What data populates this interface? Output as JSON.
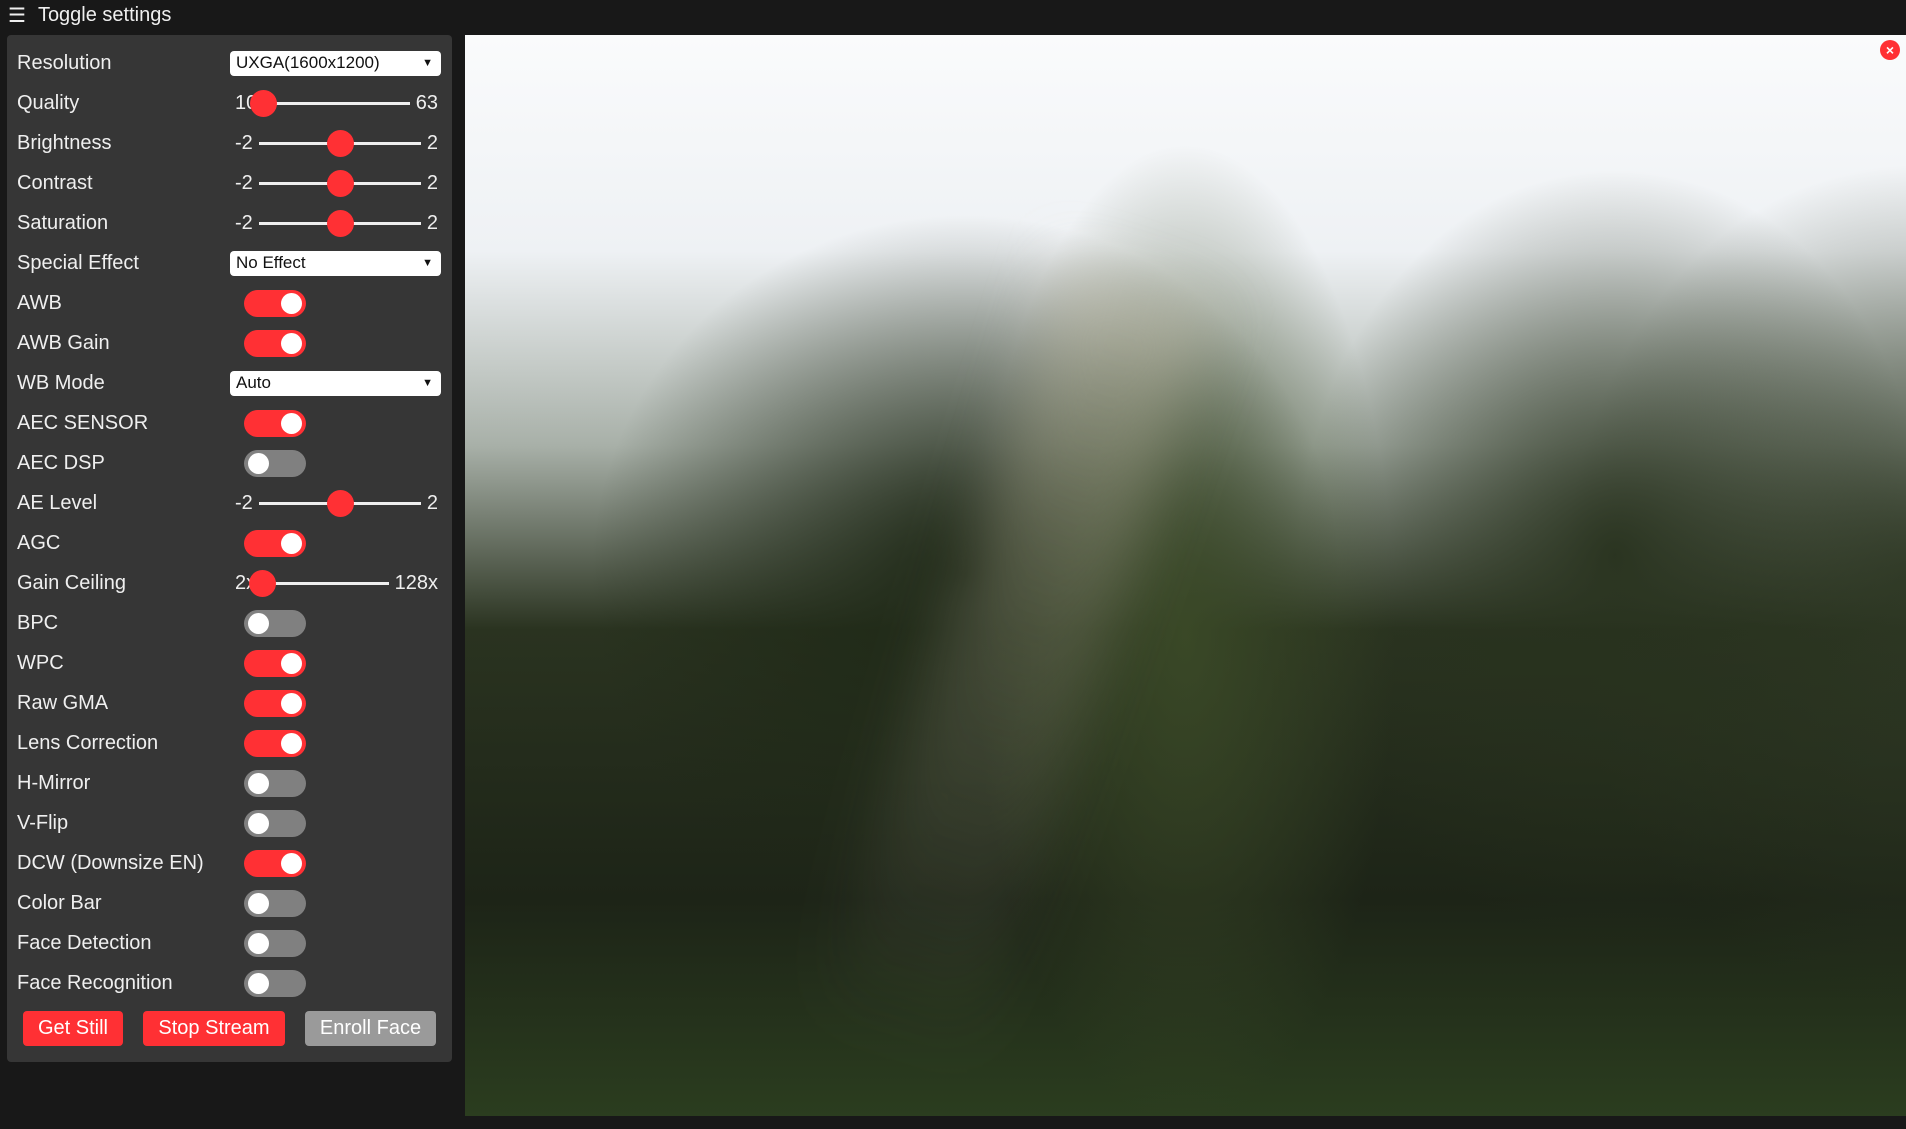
{
  "header": {
    "icon": "hamburger-icon",
    "label": "Toggle settings"
  },
  "accent_color": "#ff3034",
  "controls": [
    {
      "label": "Resolution",
      "type": "select",
      "value": "UXGA(1600x1200)"
    },
    {
      "label": "Quality",
      "type": "range",
      "min": "10",
      "max": "63",
      "value": 10
    },
    {
      "label": "Brightness",
      "type": "range",
      "min": "-2",
      "max": "2",
      "value": 0
    },
    {
      "label": "Contrast",
      "type": "range",
      "min": "-2",
      "max": "2",
      "value": 0
    },
    {
      "label": "Saturation",
      "type": "range",
      "min": "-2",
      "max": "2",
      "value": 0
    },
    {
      "label": "Special Effect",
      "type": "select",
      "value": "No Effect"
    },
    {
      "label": "AWB",
      "type": "toggle",
      "on": true
    },
    {
      "label": "AWB Gain",
      "type": "toggle",
      "on": true
    },
    {
      "label": "WB Mode",
      "type": "select",
      "value": "Auto"
    },
    {
      "label": "AEC SENSOR",
      "type": "toggle",
      "on": true
    },
    {
      "label": "AEC DSP",
      "type": "toggle",
      "on": false
    },
    {
      "label": "AE Level",
      "type": "range",
      "min": "-2",
      "max": "2",
      "value": 0
    },
    {
      "label": "AGC",
      "type": "toggle",
      "on": true
    },
    {
      "label": "Gain Ceiling",
      "type": "range",
      "min": "2x",
      "max": "128x",
      "value": 0,
      "fraction": 0
    },
    {
      "label": "BPC",
      "type": "toggle",
      "on": false
    },
    {
      "label": "WPC",
      "type": "toggle",
      "on": true
    },
    {
      "label": "Raw GMA",
      "type": "toggle",
      "on": true
    },
    {
      "label": "Lens Correction",
      "type": "toggle",
      "on": true
    },
    {
      "label": "H-Mirror",
      "type": "toggle",
      "on": false
    },
    {
      "label": "V-Flip",
      "type": "toggle",
      "on": false
    },
    {
      "label": "DCW (Downsize EN)",
      "type": "toggle",
      "on": true
    },
    {
      "label": "Color Bar",
      "type": "toggle",
      "on": false
    },
    {
      "label": "Face Detection",
      "type": "toggle",
      "on": false
    },
    {
      "label": "Face Recognition",
      "type": "toggle",
      "on": false
    }
  ],
  "buttons": {
    "get_still": "Get Still",
    "stop_stream": "Stop Stream",
    "enroll_face": "Enroll Face"
  },
  "stream": {
    "close_icon": "close-icon",
    "close_glyph": "×"
  }
}
